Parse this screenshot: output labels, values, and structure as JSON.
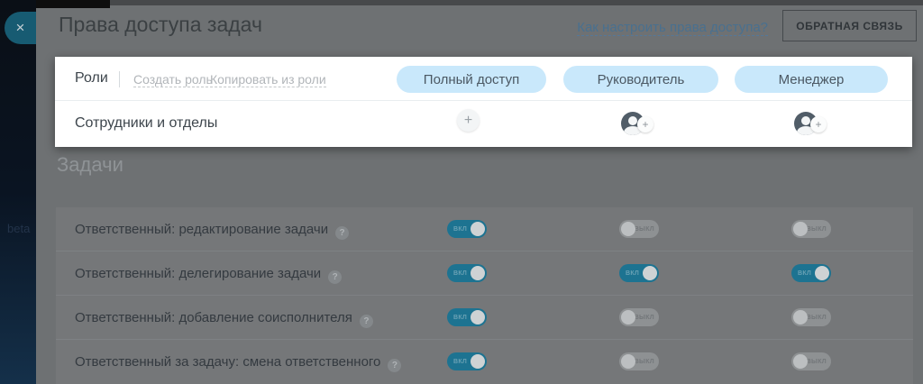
{
  "page": {
    "title": "Права доступа задач",
    "help_link": "Как настроить права доступа?",
    "feedback_button": "ОБРАТНАЯ СВЯЗЬ"
  },
  "sidebar": {
    "beta_label": "beta"
  },
  "icons": {
    "close": "×",
    "plus": "+",
    "question": "?"
  },
  "roles_panel": {
    "roles_label": "Роли",
    "create_role": "Создать роль",
    "copy_role": "Копировать из роли",
    "roles": [
      "Полный доступ",
      "Руководитель",
      "Менеджер"
    ],
    "employees_label": "Сотрудники и отделы"
  },
  "tasks_section": {
    "title": "Задачи",
    "toggle_on_label": "ВКЛ",
    "toggle_off_label": "ВЫКЛ",
    "columns": [
      "full-access",
      "supervisor",
      "manager"
    ],
    "rows": [
      {
        "label": "Ответственный: редактирование задачи",
        "states": [
          true,
          false,
          false
        ]
      },
      {
        "label": "Ответственный: делегирование задачи",
        "states": [
          true,
          true,
          true
        ]
      },
      {
        "label": "Ответственный: добавление соисполнителя",
        "states": [
          true,
          false,
          false
        ]
      },
      {
        "label": "Ответственный за задачу: смена ответственного",
        "states": [
          true,
          false,
          false
        ]
      }
    ]
  },
  "colors": {
    "accent_toggle_on": "#1d7391",
    "role_pill_bg": "#c9e8fb",
    "overlay_gray": "#6e7173",
    "highlight_card_bg": "#ffffff"
  }
}
